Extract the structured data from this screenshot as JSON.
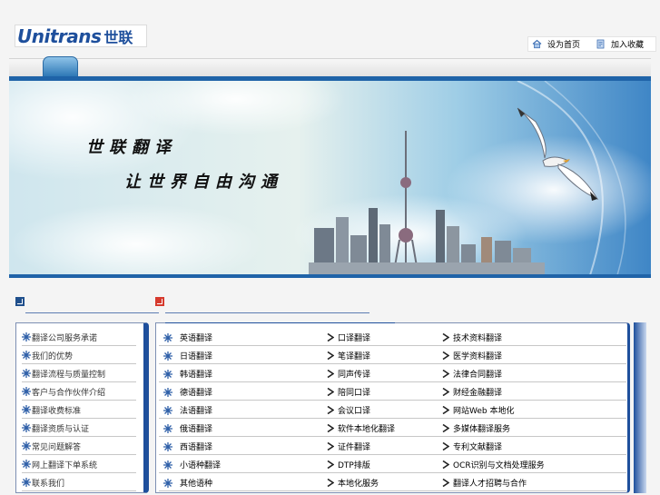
{
  "header": {
    "logo_en": "Unitrans",
    "logo_cn": "世联",
    "links": [
      {
        "label": "设为首页",
        "icon": "home-icon"
      },
      {
        "label": "加入收藏",
        "icon": "bookmark-icon"
      }
    ]
  },
  "banner": {
    "slogan_line1": "世联翻译",
    "slogan_line2": "让世界自由沟通"
  },
  "left_list": [
    "翻译公司服务承诺",
    "我们的优势",
    "翻译流程与质量控制",
    "客户与合作伙伴介绍",
    "翻译收费标准",
    "翻译资质与认证",
    "常见问题解答",
    "网上翻译下单系统",
    "联系我们"
  ],
  "services": [
    [
      "英语翻译",
      "口译翻译",
      "技术资料翻译"
    ],
    [
      "日语翻译",
      "笔译翻译",
      "医学资料翻译"
    ],
    [
      "韩语翻译",
      "同声传译",
      "法律合同翻译"
    ],
    [
      "德语翻译",
      "陪同口译",
      "财经金融翻译"
    ],
    [
      "法语翻译",
      "会议口译",
      "网站Web 本地化"
    ],
    [
      "俄语翻译",
      "软件本地化翻译",
      "多媒体翻译服务"
    ],
    [
      "西语翻译",
      "证件翻译",
      "专利文献翻译"
    ],
    [
      "小语种翻译",
      "DTP排版",
      "OCR识别与文档处理服务"
    ],
    [
      "其他语种",
      "本地化服务",
      "翻译人才招聘与合作"
    ]
  ],
  "colors": {
    "brand_blue": "#1e4f9c",
    "accent_red": "#d63a2d"
  }
}
